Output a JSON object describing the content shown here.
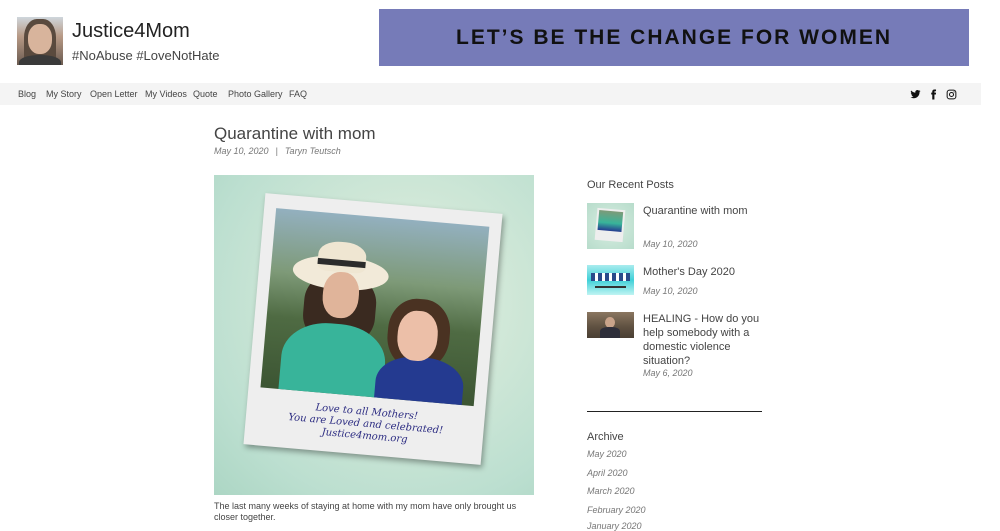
{
  "header": {
    "title": "Justice4Mom",
    "tags": "#NoAbuse #LoveNotHate",
    "banner_text": "LET’S BE THE CHANGE FOR WOMEN",
    "banner_color": "#767bb8"
  },
  "nav": {
    "items": [
      "Blog",
      "My Story",
      "Open Letter",
      "My Videos",
      "Quote",
      "Photo Gallery",
      "FAQ"
    ],
    "social_icons": [
      "twitter-icon",
      "facebook-icon",
      "instagram-icon"
    ]
  },
  "post": {
    "title": "Quarantine with mom",
    "date": "May 10, 2020",
    "separator": "|",
    "author": "Taryn Teutsch",
    "image_caption": {
      "line1": "Love to all Mothers!",
      "line2": "You are Loved and celebrated!",
      "line3": "Justice4mom.org"
    },
    "text": "The last many weeks of staying at home with my mom have only brought us closer together."
  },
  "sidebar": {
    "recent_heading": "Our Recent Posts",
    "recent_posts": [
      {
        "title": "Quarantine with mom",
        "date": "May 10, 2020"
      },
      {
        "title": "Mother's Day 2020",
        "date": "May 10, 2020"
      },
      {
        "title": "HEALING - How do you help somebody with a domestic violence situation?",
        "date": "May 6, 2020"
      }
    ],
    "archive_heading": "Archive",
    "archive": [
      "May 2020",
      "April 2020",
      "March 2020",
      "February 2020",
      "January 2020"
    ]
  }
}
